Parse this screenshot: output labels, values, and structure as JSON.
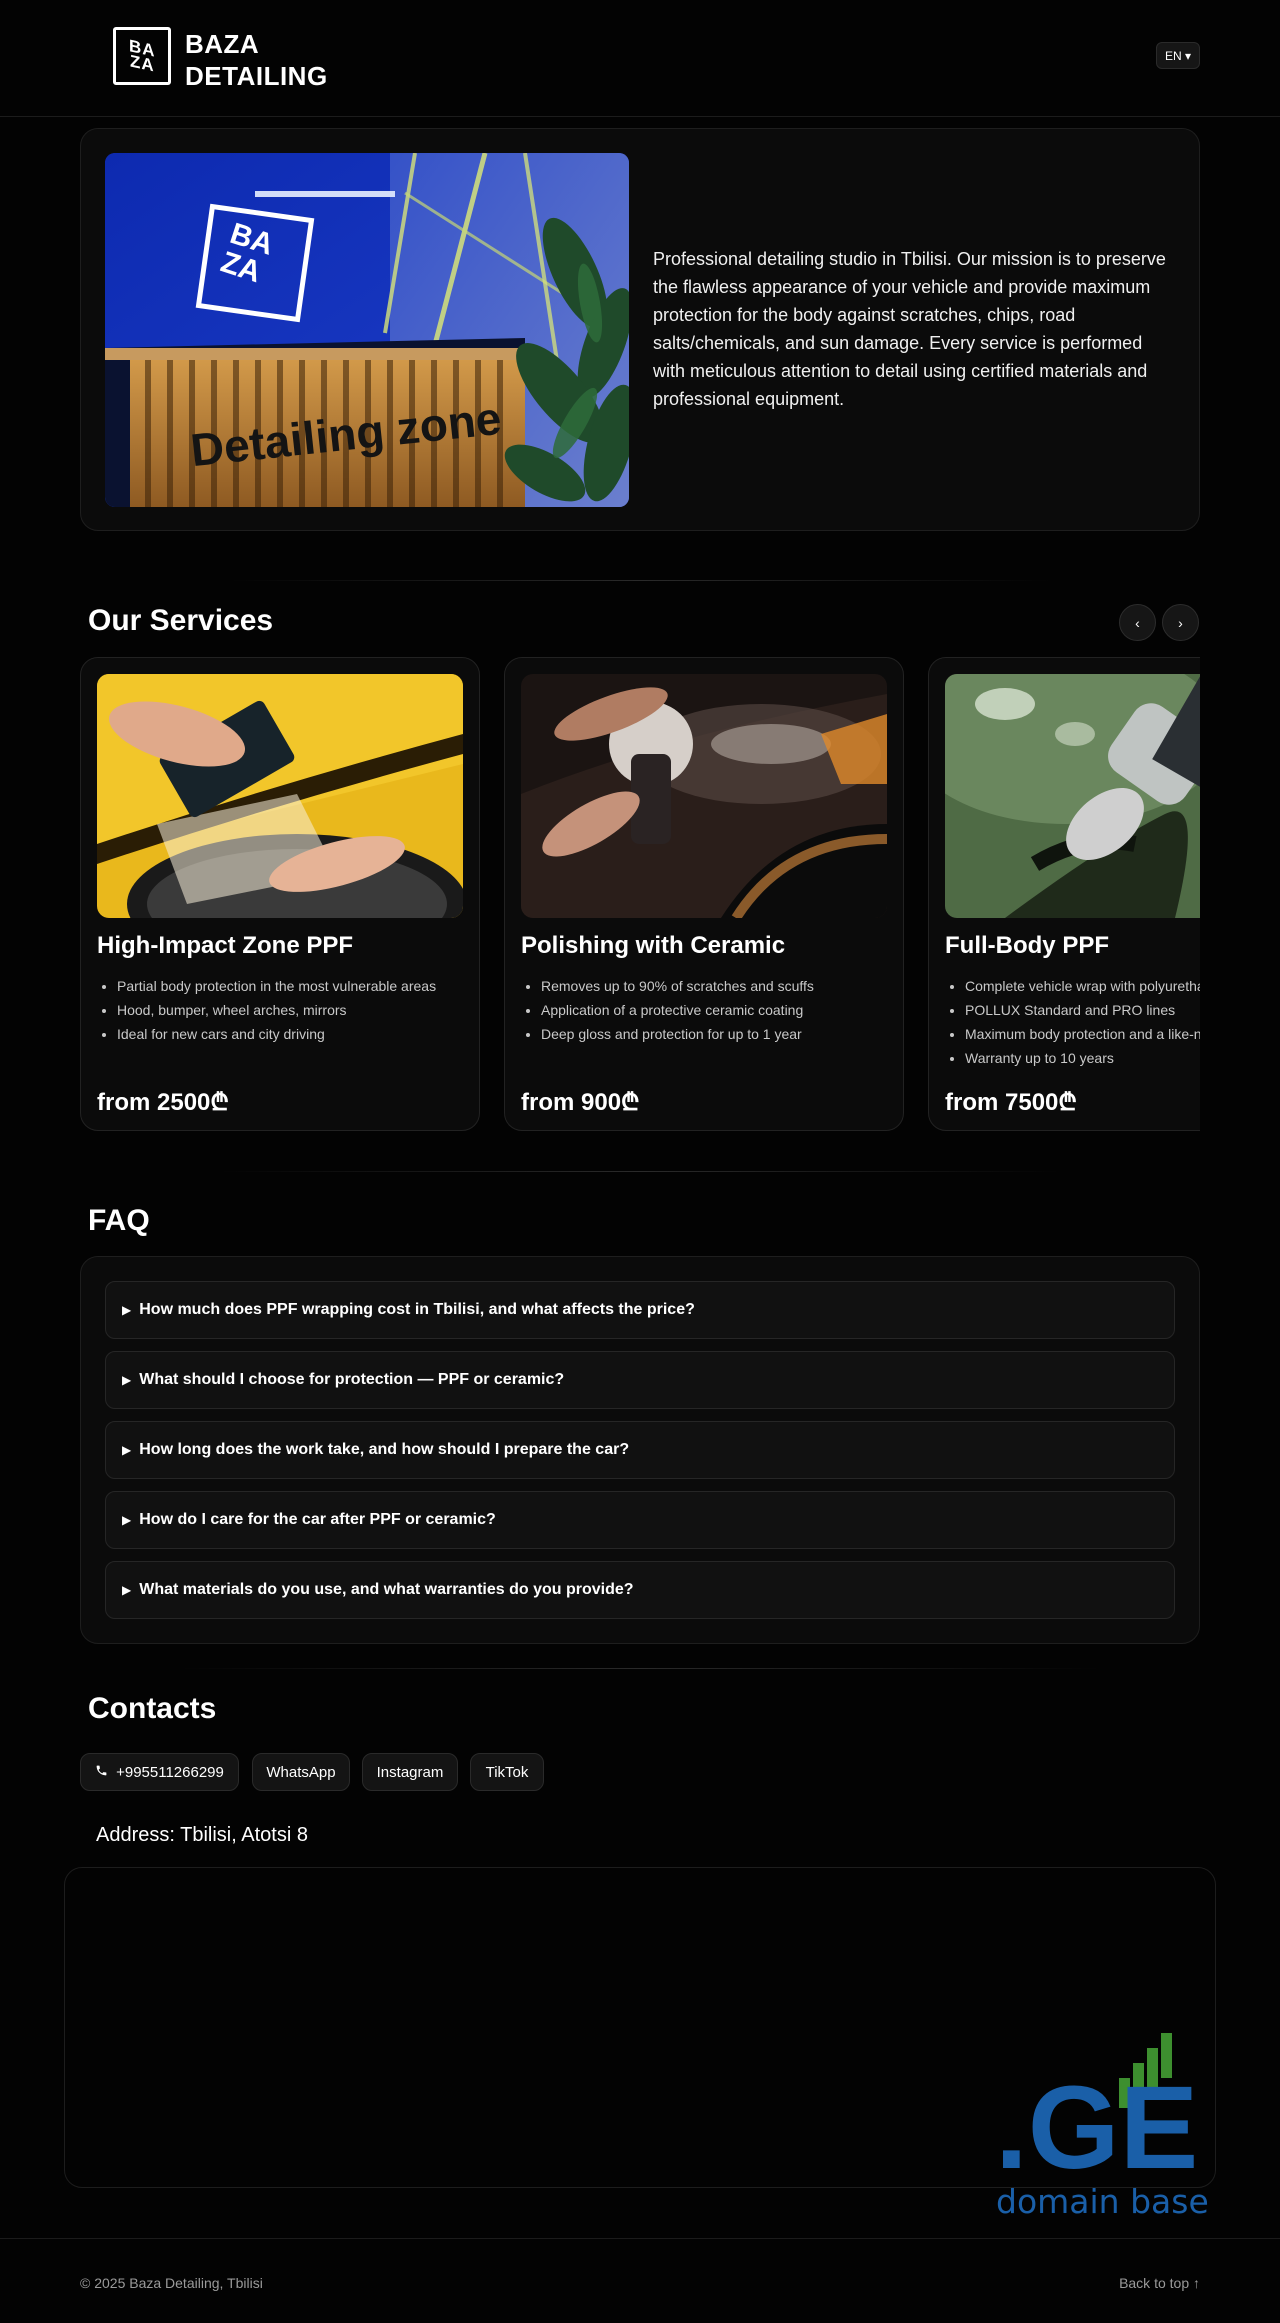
{
  "header": {
    "logo_lines": [
      "BA",
      "ZA",
      "ZA"
    ],
    "brand_line1": "BAZA",
    "brand_line2": "DETAILING",
    "language_label": "EN ▾"
  },
  "hero": {
    "image_alt": "Baza detailing studio reception with Detailing zone sign",
    "sign_text": "Detailing zone",
    "logo_text": "BAZA",
    "description": "Professional detailing studio in Tbilisi. Our mission is to preserve the flawless appearance of your vehicle and provide maximum protection for the body against scratches, chips, road salts/chemicals, and sun damage. Every service is performed with meticulous attention to detail using certified materials and professional equipment."
  },
  "services": {
    "title": "Our Services",
    "prev_label": "‹",
    "next_label": "›",
    "items": [
      {
        "title": "High-Impact Zone PPF",
        "features": [
          "Partial body protection in the most vulnerable areas",
          "Hood, bumper, wheel arches, mirrors",
          "Ideal for new cars and city driving"
        ],
        "price": "from 2500₾"
      },
      {
        "title": "Polishing with Ceramic",
        "features": [
          "Removes up to 90% of scratches and scuffs",
          "Application of a protective ceramic coating",
          "Deep gloss and protection for up to 1 year"
        ],
        "price": "from 900₾"
      },
      {
        "title": "Full-Body PPF",
        "features": [
          "Complete vehicle wrap with polyurethane film",
          "POLLUX Standard and PRO lines",
          "Maximum body protection and a like-new look",
          "Warranty up to 10 years"
        ],
        "price": "from 7500₾"
      }
    ]
  },
  "faq": {
    "title": "FAQ",
    "items": [
      "How much does PPF wrapping cost in Tbilisi, and what affects the price?",
      "What should I choose for protection — PPF or ceramic?",
      "How long does the work take, and how should I prepare the car?",
      "How do I care for the car after PPF or ceramic?",
      "What materials do you use, and what warranties do you provide?"
    ]
  },
  "contacts": {
    "title": "Contacts",
    "phone": "+995511266299",
    "whatsapp": "WhatsApp",
    "instagram": "Instagram",
    "tiktok": "TikTok",
    "address": "Address: Tbilisi, Atotsi 8"
  },
  "map_widget": {
    "logo_text": ".GE",
    "tagline": "domain base"
  },
  "footer": {
    "copyright": "© 2025 Baza Detailing, Tbilisi",
    "back_to_top": "Back to top ↑"
  },
  "colors": {
    "background": "#030303",
    "card": "#0b0b0b",
    "ge_blue": "#1a5fa8",
    "ge_green": "#3d8f2f"
  }
}
